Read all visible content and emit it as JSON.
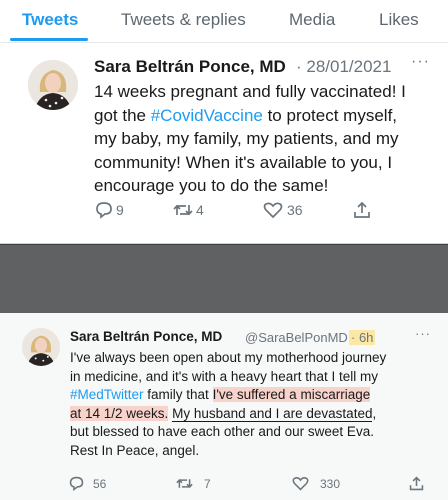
{
  "tabs": [
    "Tweets",
    "Tweets & replies",
    "Media",
    "Likes"
  ],
  "tweet1": {
    "name": "Sara Beltrán Ponce, MD",
    "date": "· 28/01/2021",
    "more": "···",
    "line1": "14 weeks pregnant and fully vaccinated! I",
    "line2_a": "got the ",
    "hashtag": "#CovidVaccine",
    "line2_b": " to protect myself,",
    "line3": "my baby, my family, my patients, and my",
    "line4": "community! When it's available to you, I",
    "line5": "encourage you to do the same!",
    "replies": "9",
    "retweets": "4",
    "likes": "36"
  },
  "tweet2": {
    "name": "Sara Beltrán Ponce, MD",
    "handle": "@SaraBelPonMD",
    "time": "· 6h",
    "more": "···",
    "line1": "I've always been open about my motherhood journey",
    "line2": "in medicine, and it's with a heavy heart that I tell my",
    "line3_hashtag": "#MedTwitter",
    "line3_b": " family that ",
    "line3_hl": "I've suffered a miscarriage",
    "line4_hl": "at 14 1/2 weeks.",
    "line4_b": " ",
    "line4_ul": "My husband and I are devastated",
    "line4_c": ",",
    "line5": "but blessed to have each other and our sweet Eva.",
    "line6": "Rest In Peace, angel.",
    "replies": "56",
    "retweets": "7",
    "likes": "330"
  },
  "colors": {
    "accent": "#1d9bf0",
    "muted": "#6b757d",
    "highlight_yellow": "#fbe8a6",
    "highlight_red": "#f8d3cc"
  },
  "icons": [
    "reply-icon",
    "retweet-icon",
    "like-icon",
    "share-icon",
    "more-icon"
  ]
}
